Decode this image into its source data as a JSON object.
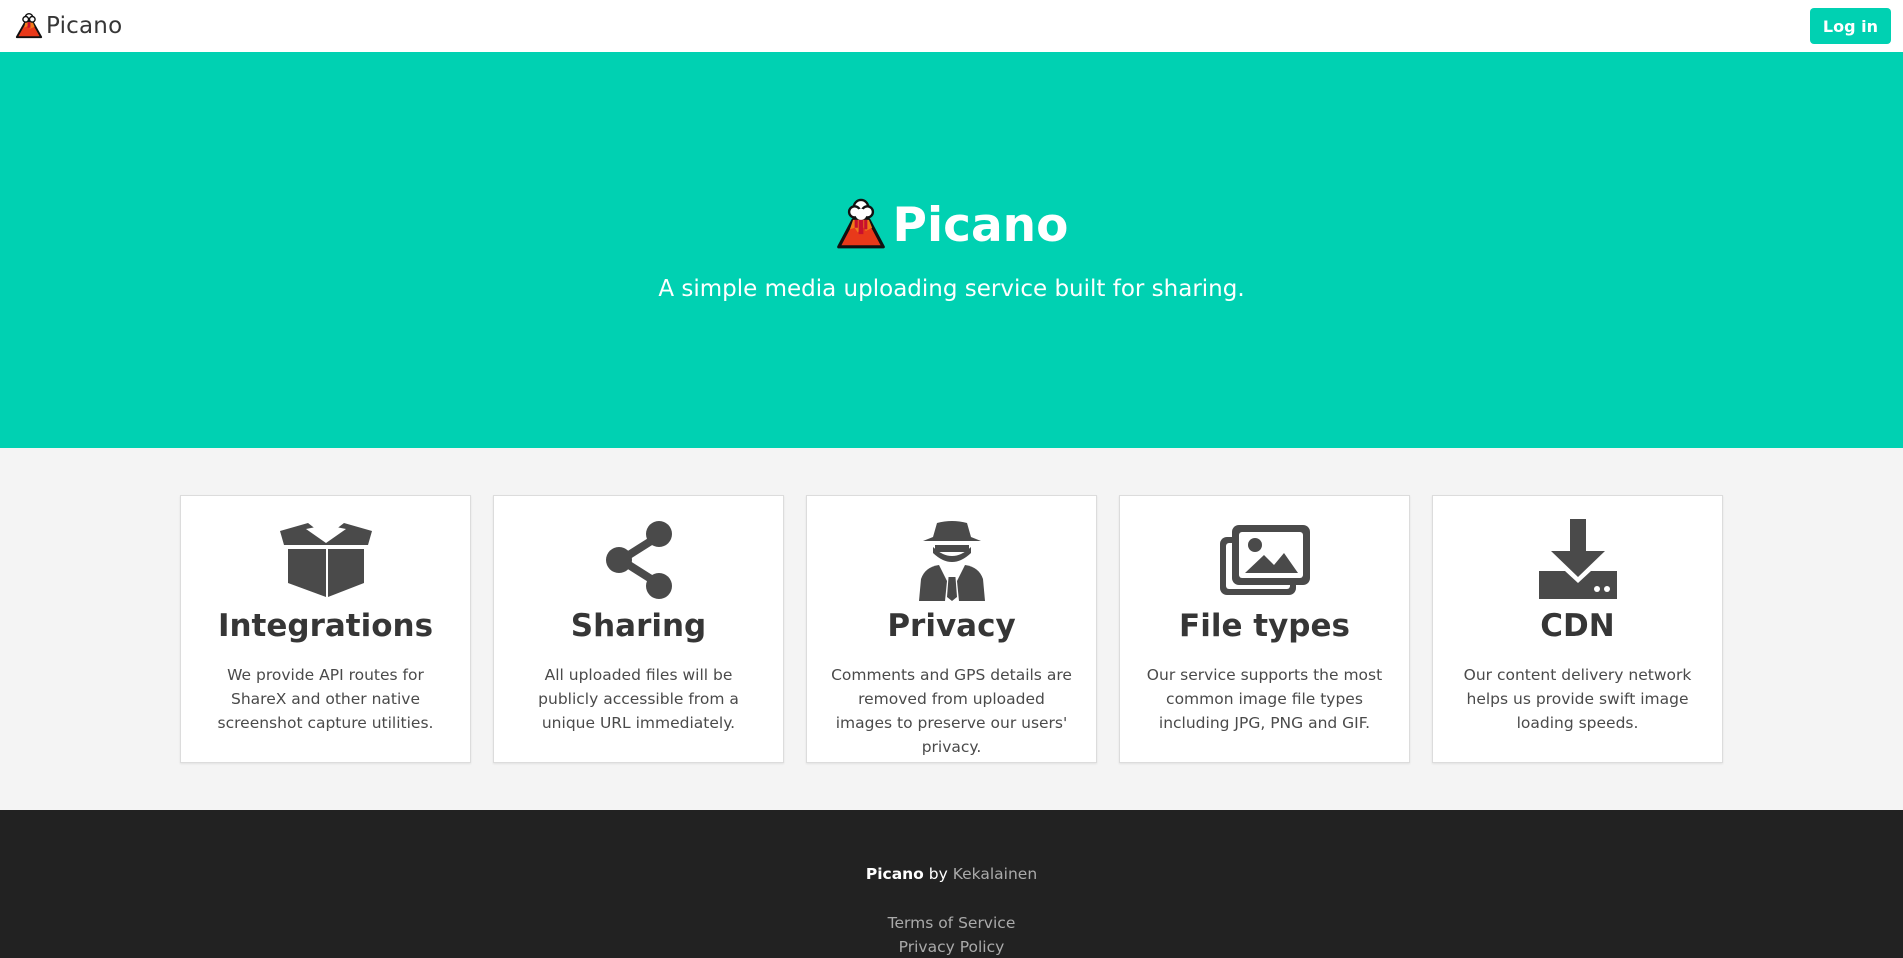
{
  "navbar": {
    "brand_name": "Picano",
    "brand_icon": "volcano-logo-icon",
    "login_label": "Log in"
  },
  "hero": {
    "title": "Picano",
    "subtitle": "A simple media uploading service built for sharing.",
    "background_color": "#00d1b2"
  },
  "features": [
    {
      "icon": "box-open-icon",
      "title": "Integrations",
      "text": "We provide API routes for ShareX and other native screenshot capture utilities."
    },
    {
      "icon": "share-icon",
      "title": "Sharing",
      "text": "All uploaded files will be publicly accessible from a unique URL immediately."
    },
    {
      "icon": "user-secret-icon",
      "title": "Privacy",
      "text": "Comments and GPS details are removed from uploaded images to preserve our users' privacy."
    },
    {
      "icon": "images-icon",
      "title": "File types",
      "text": "Our service supports the most common image file types including JPG, PNG and GIF."
    },
    {
      "icon": "download-icon",
      "title": "CDN",
      "text": "Our content delivery network helps us provide swift image loading speeds."
    }
  ],
  "footer": {
    "brand": "Picano",
    "by": "by",
    "author": "Kekalainen",
    "links": [
      "Terms of Service",
      "Privacy Policy"
    ]
  },
  "colors": {
    "accent": "#00d1b2",
    "footer_bg": "#222222",
    "icon": "#4a4a4a"
  }
}
